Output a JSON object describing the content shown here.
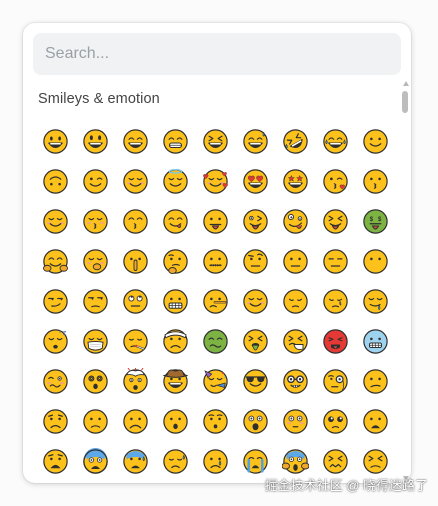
{
  "search": {
    "placeholder": "Search..."
  },
  "category": {
    "title": "Smileys & emotion"
  },
  "watermark": "掘金技术社区 @ 晓得迷路了",
  "colors": {
    "face": "#FCC21B",
    "outline": "#2F2F2F",
    "tongue": "#E0484A",
    "blush": "#F29B9B",
    "heart": "#E53935",
    "tear": "#4FA3E0",
    "green": "#7CB342",
    "red": "#E53935",
    "blue": "#9ED3F0"
  },
  "emojis": [
    {
      "name": "grinning-face",
      "char": "😀",
      "type": "grin"
    },
    {
      "name": "grinning-face-big-eyes",
      "char": "😃",
      "type": "grin-big"
    },
    {
      "name": "grinning-face-smiling-eyes",
      "char": "😄",
      "type": "grin-smile"
    },
    {
      "name": "beaming-face",
      "char": "😁",
      "type": "beam"
    },
    {
      "name": "grinning-squinting-face",
      "char": "😆",
      "type": "squint"
    },
    {
      "name": "grinning-face-sweat",
      "char": "😅",
      "type": "sweat-grin"
    },
    {
      "name": "rolling-on-floor-laughing",
      "char": "🤣",
      "type": "rofl"
    },
    {
      "name": "face-tears-of-joy",
      "char": "😂",
      "type": "joy"
    },
    {
      "name": "slightly-smiling-face",
      "char": "🙂",
      "type": "slight"
    },
    {
      "name": "upside-down-face",
      "char": "🙃",
      "type": "upside"
    },
    {
      "name": "winking-face",
      "char": "😉",
      "type": "wink"
    },
    {
      "name": "smiling-face-smiling-eyes",
      "char": "😊",
      "type": "blush-smile"
    },
    {
      "name": "smiling-face-halo",
      "char": "😇",
      "type": "halo"
    },
    {
      "name": "smiling-face-hearts",
      "char": "🥰",
      "type": "hearts"
    },
    {
      "name": "heart-eyes",
      "char": "😍",
      "type": "heart-eyes"
    },
    {
      "name": "star-struck",
      "char": "🤩",
      "type": "star-eyes"
    },
    {
      "name": "face-blowing-kiss",
      "char": "😘",
      "type": "kiss-heart"
    },
    {
      "name": "kissing-face",
      "char": "😗",
      "type": "kiss"
    },
    {
      "name": "smiling-face",
      "char": "☺",
      "type": "blush-smile"
    },
    {
      "name": "kissing-face-closed-eyes",
      "char": "😚",
      "type": "kiss-closed"
    },
    {
      "name": "kissing-face-smiling-eyes",
      "char": "😙",
      "type": "kiss-smile"
    },
    {
      "name": "face-savoring-food",
      "char": "😋",
      "type": "yum"
    },
    {
      "name": "face-with-tongue",
      "char": "😛",
      "type": "tongue"
    },
    {
      "name": "winking-face-tongue",
      "char": "😜",
      "type": "wink-tongue"
    },
    {
      "name": "zany-face",
      "char": "🤪",
      "type": "zany"
    },
    {
      "name": "squinting-face-tongue",
      "char": "😝",
      "type": "squint-tongue"
    },
    {
      "name": "money-mouth-face",
      "char": "🤑",
      "type": "money"
    },
    {
      "name": "hugging-face",
      "char": "🤗",
      "type": "hug"
    },
    {
      "name": "face-hand-over-mouth",
      "char": "🤭",
      "type": "hand-mouth"
    },
    {
      "name": "shushing-face",
      "char": "🤫",
      "type": "shush"
    },
    {
      "name": "thinking-face",
      "char": "🤔",
      "type": "think"
    },
    {
      "name": "zipper-mouth-face",
      "char": "🤐",
      "type": "zipper"
    },
    {
      "name": "face-raised-eyebrow",
      "char": "🤨",
      "type": "eyebrow"
    },
    {
      "name": "neutral-face",
      "char": "😐",
      "type": "neutral"
    },
    {
      "name": "expressionless-face",
      "char": "😑",
      "type": "expressionless"
    },
    {
      "name": "face-without-mouth",
      "char": "😶",
      "type": "no-mouth"
    },
    {
      "name": "smirking-face",
      "char": "😏",
      "type": "smirk"
    },
    {
      "name": "unamused-face",
      "char": "😒",
      "type": "unamused"
    },
    {
      "name": "face-rolling-eyes",
      "char": "🙄",
      "type": "roll-eyes"
    },
    {
      "name": "grimacing-face",
      "char": "😬",
      "type": "grimace"
    },
    {
      "name": "lying-face",
      "char": "🤥",
      "type": "lying"
    },
    {
      "name": "relieved-face",
      "char": "😌",
      "type": "relieved"
    },
    {
      "name": "pensive-face",
      "char": "😔",
      "type": "pensive"
    },
    {
      "name": "sleepy-face",
      "char": "😪",
      "type": "sleepy"
    },
    {
      "name": "drooling-face",
      "char": "🤤",
      "type": "drool"
    },
    {
      "name": "sleeping-face",
      "char": "😴",
      "type": "sleeping"
    },
    {
      "name": "face-medical-mask",
      "char": "😷",
      "type": "mask"
    },
    {
      "name": "face-thermometer",
      "char": "🤒",
      "type": "thermo"
    },
    {
      "name": "face-head-bandage",
      "char": "🤕",
      "type": "bandage"
    },
    {
      "name": "nauseated-face",
      "char": "🤢",
      "type": "nauseated"
    },
    {
      "name": "face-vomiting",
      "char": "🤮",
      "type": "vomit"
    },
    {
      "name": "sneezing-face",
      "char": "🤧",
      "type": "sneeze"
    },
    {
      "name": "hot-face",
      "char": "🥵",
      "type": "hot"
    },
    {
      "name": "cold-face",
      "char": "🥶",
      "type": "cold"
    },
    {
      "name": "woozy-face",
      "char": "🥴",
      "type": "woozy"
    },
    {
      "name": "face-spiral-eyes",
      "char": "😵",
      "type": "dizzy"
    },
    {
      "name": "exploding-head",
      "char": "🤯",
      "type": "explode"
    },
    {
      "name": "cowboy-hat-face",
      "char": "🤠",
      "type": "cowboy"
    },
    {
      "name": "partying-face",
      "char": "🥳",
      "type": "party"
    },
    {
      "name": "smiling-face-sunglasses",
      "char": "😎",
      "type": "cool"
    },
    {
      "name": "nerd-face",
      "char": "🤓",
      "type": "nerd"
    },
    {
      "name": "face-monocle",
      "char": "🧐",
      "type": "monocle"
    },
    {
      "name": "confused-face",
      "char": "😕",
      "type": "confused"
    },
    {
      "name": "worried-face",
      "char": "😟",
      "type": "worried"
    },
    {
      "name": "slightly-frowning-face",
      "char": "🙁",
      "type": "frown-slight"
    },
    {
      "name": "frowning-face",
      "char": "☹",
      "type": "frown"
    },
    {
      "name": "face-open-mouth",
      "char": "😮",
      "type": "open"
    },
    {
      "name": "hushed-face",
      "char": "😯",
      "type": "hushed"
    },
    {
      "name": "astonished-face",
      "char": "😲",
      "type": "astonished"
    },
    {
      "name": "flushed-face",
      "char": "😳",
      "type": "flushed"
    },
    {
      "name": "pleading-face",
      "char": "🥺",
      "type": "pleading"
    },
    {
      "name": "frowning-face-open-mouth",
      "char": "😦",
      "type": "frown-open"
    },
    {
      "name": "anguished-face",
      "char": "😧",
      "type": "anguished"
    },
    {
      "name": "fearful-face",
      "char": "😨",
      "type": "fearful"
    },
    {
      "name": "anxious-face-sweat",
      "char": "😰",
      "type": "anxious"
    },
    {
      "name": "sad-relieved-face",
      "char": "😥",
      "type": "sad-relieved"
    },
    {
      "name": "crying-face",
      "char": "😢",
      "type": "cry"
    },
    {
      "name": "loudly-crying-face",
      "char": "😭",
      "type": "sob"
    },
    {
      "name": "face-screaming-fear",
      "char": "😱",
      "type": "scream"
    },
    {
      "name": "confounded-face",
      "char": "😖",
      "type": "confounded"
    },
    {
      "name": "persevering-face",
      "char": "😣",
      "type": "persevere"
    }
  ]
}
